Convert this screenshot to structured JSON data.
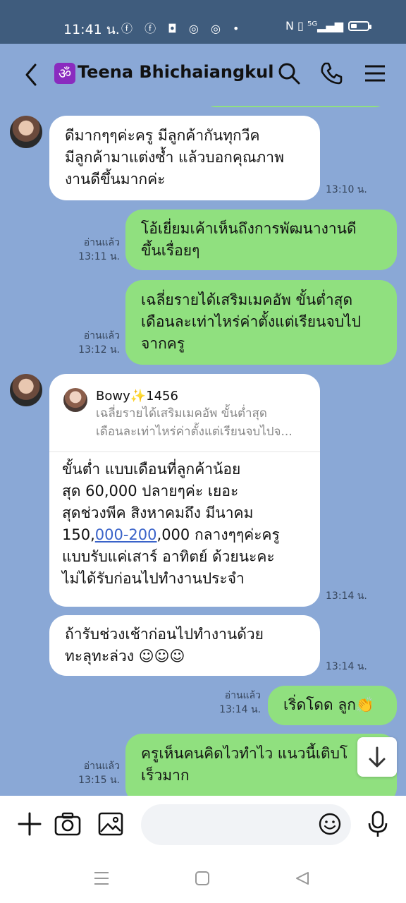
{
  "status": {
    "time": "11:41 น."
  },
  "header": {
    "title": "Teena Bhichaiangkul",
    "om_glyph": "ॐ"
  },
  "messages": [
    {
      "side": "left",
      "lines": [
        "ดีมากๆๆค่ะครู มีลูกค้ากันทุกวีค",
        "มีลูกค้ามาแต่งซ้ำ แล้วบอกคุณภาพ",
        "งานดีขึ้นมากค่ะ"
      ],
      "time": "13:10 น."
    },
    {
      "side": "right",
      "lines": [
        "โอ้เยี่ยมเค้าเห็นถึงการพัฒนางานดี",
        "ขึ้นเรื่อยๆ"
      ],
      "read": "อ่านแล้ว",
      "time": "13:11 น."
    },
    {
      "side": "right",
      "lines": [
        "เฉลี่ยรายได้เสริมเมคอัพ ขั้นต่ำสุด",
        "เดือนละเท่าไหร่ค่าตั้งแต่เรียนจบไป",
        "จากครู"
      ],
      "read": "อ่านแล้ว",
      "time": "13:12 น."
    },
    {
      "side": "left",
      "quote": {
        "name": "Bowy✨1456",
        "lines": [
          "เฉลี่ยรายได้เสริมเมคอัพ ขั้นต่ำสุด",
          "เดือนละเท่าไหร่ค่าตั้งแต่เรียนจบไปจ..."
        ]
      },
      "lines": [
        "ขั้นต่ำ แบบเดือนที่ลูกค้าน้อย",
        "สุด 60,000 ปลายๆค่ะ เยอะ",
        "สุดช่วงพีค สิงหาคมถึง มีนาคม",
        "กลางๆๆค่ะครู",
        "แบบรับแค่เสาร์ อาทิตย์ ด้วยนะคะ",
        "ไม่ได้รับก่อนไปทำงานประจำ"
      ],
      "line4_pre": "150,",
      "line4_link": "000-200",
      "line4_post": ",000 ",
      "time": "13:14 น."
    },
    {
      "side": "left",
      "lines": [
        "ถ้ารับช่วงเช้าก่อนไปทำงานด้วย",
        "ทะลุทะล่วง ☺☺☺"
      ],
      "time": "13:14 น."
    },
    {
      "side": "right",
      "lines": [
        "เริ่ดโดด ลูก👏"
      ],
      "read": "อ่านแล้ว",
      "time": "13:14 น."
    },
    {
      "side": "right",
      "lines": [
        "ครูเห็นคนคิดไวทำไว แนวนี้เติบโ",
        "เร็วมาก"
      ],
      "read": "อ่านแล้ว",
      "time": "13:15 น."
    }
  ],
  "input": {
    "placeholder": ""
  },
  "colors": {
    "chat_bg": "#8aa8d6",
    "mine_bubble": "#90e07f",
    "theirs_bubble": "#ffffff",
    "link": "#3a63c9"
  }
}
